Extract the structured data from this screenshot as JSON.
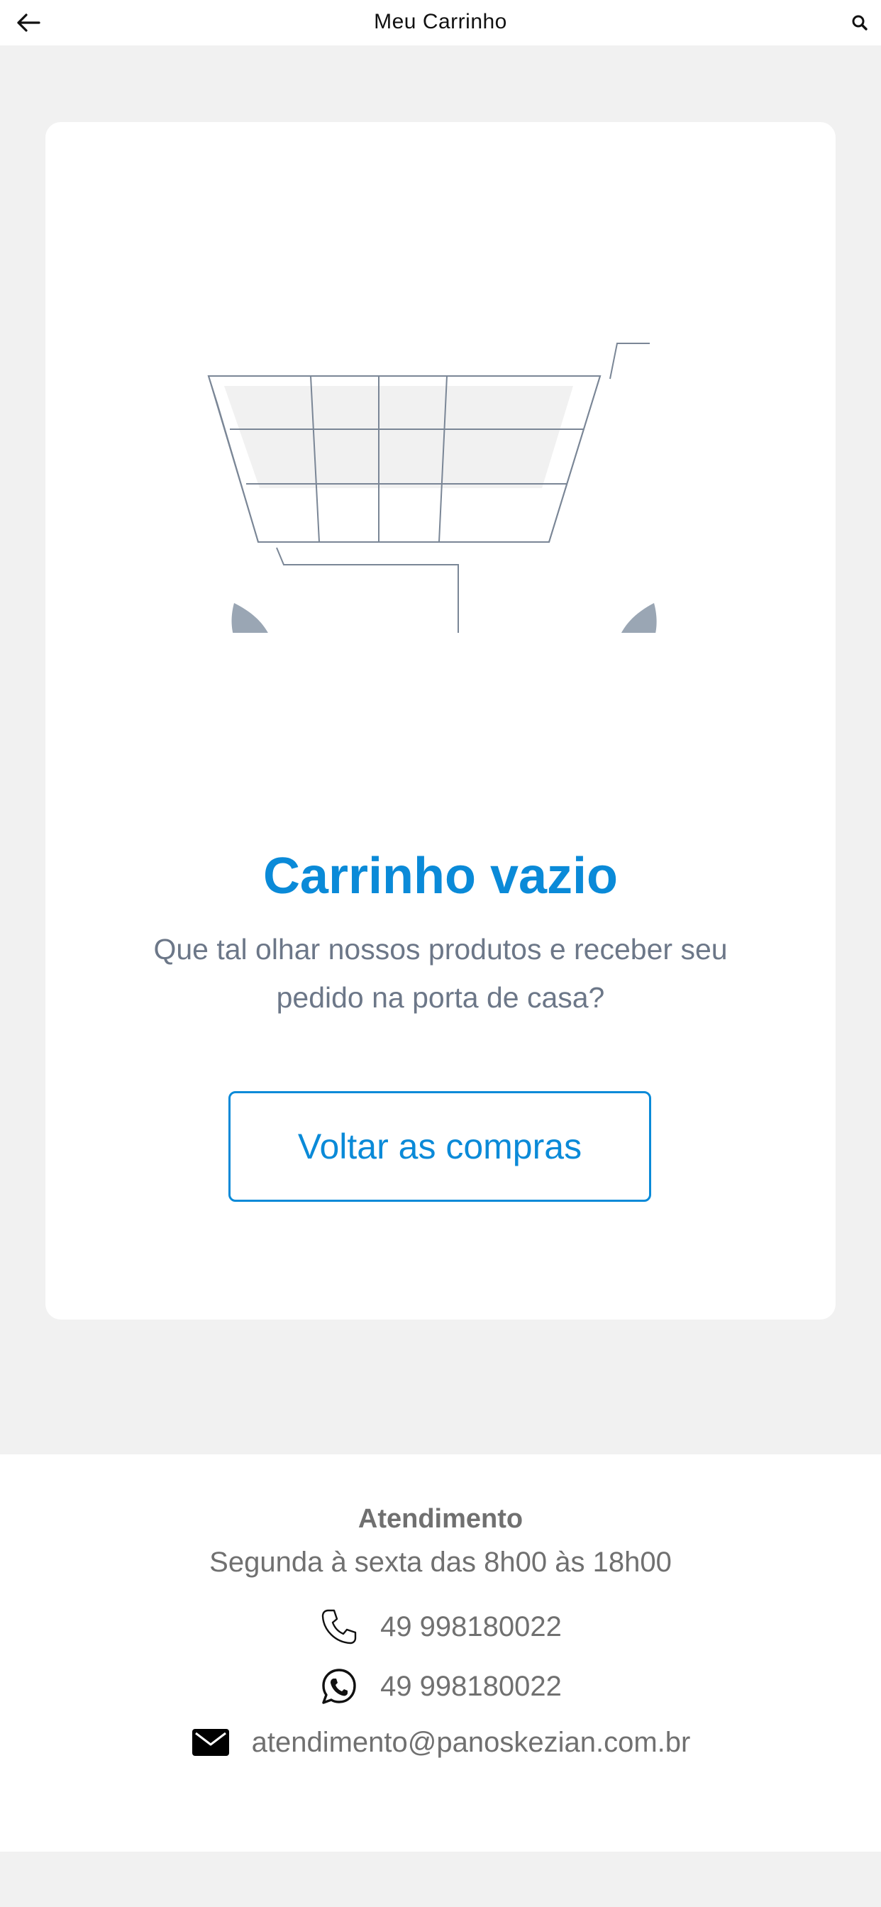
{
  "header": {
    "title": "Meu Carrinho",
    "back_icon": "arrow-left-icon",
    "search_icon": "search-icon"
  },
  "cart": {
    "illustration_icon": "empty-shopping-cart-illustration",
    "title": "Carrinho vazio",
    "message": "Que tal olhar nossos produtos e receber seu pedido na porta de casa?",
    "button_label": "Voltar as compras"
  },
  "footer": {
    "title": "Atendimento",
    "hours": "Segunda à sexta das 8h00 às 18h00",
    "phone": "49 998180022",
    "whatsapp": "49 998180022",
    "email": "atendimento@panoskezian.com.br"
  },
  "colors": {
    "accent": "#0a8ad8",
    "muted_text": "#6c7788",
    "footer_text": "#707070",
    "page_background": "#f1f1f1",
    "plant_dark": "#132c4a",
    "plant_light": "#9aa6b4"
  }
}
